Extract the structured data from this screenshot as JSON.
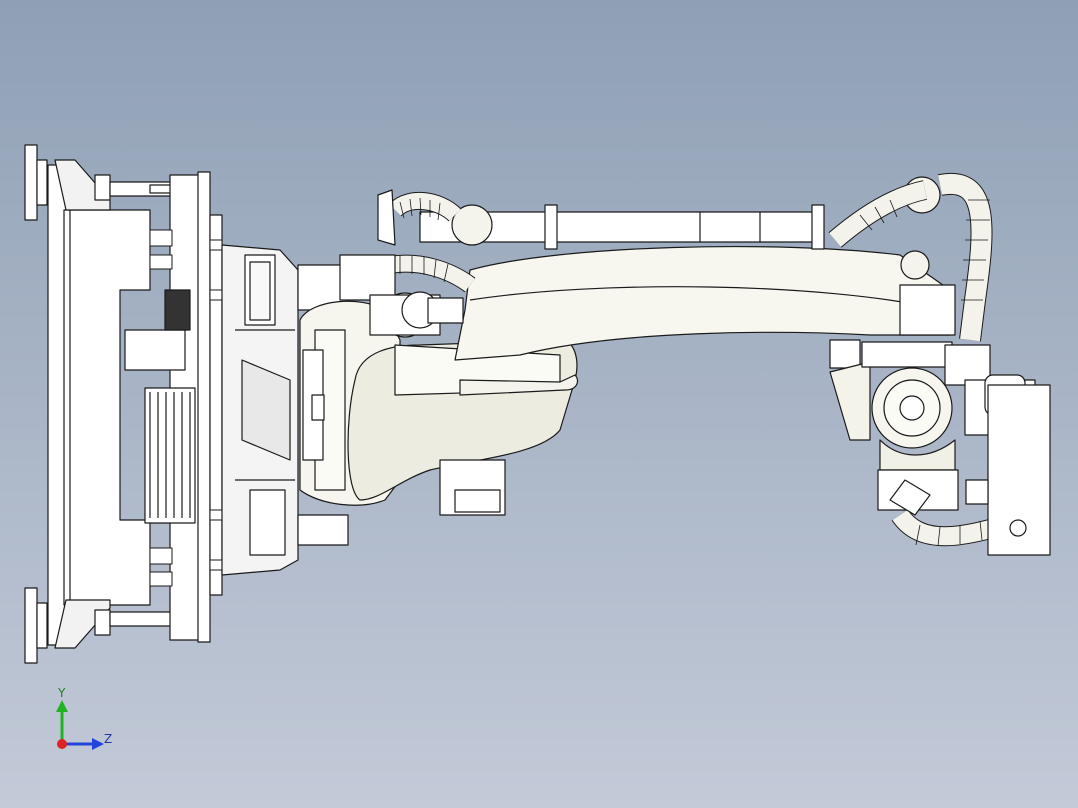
{
  "viewport": {
    "background_top": "#8fa0b5",
    "background_bottom": "#c3cad8",
    "part_fill": "#ffffff",
    "part_shade": "#e9e9dc",
    "edge_color": "#1a1a1a"
  },
  "triad": {
    "y_label": "Y",
    "z_label": "Z",
    "y_color": "#22b222",
    "z_color": "#2244dd",
    "x_color": "#dd2222"
  }
}
